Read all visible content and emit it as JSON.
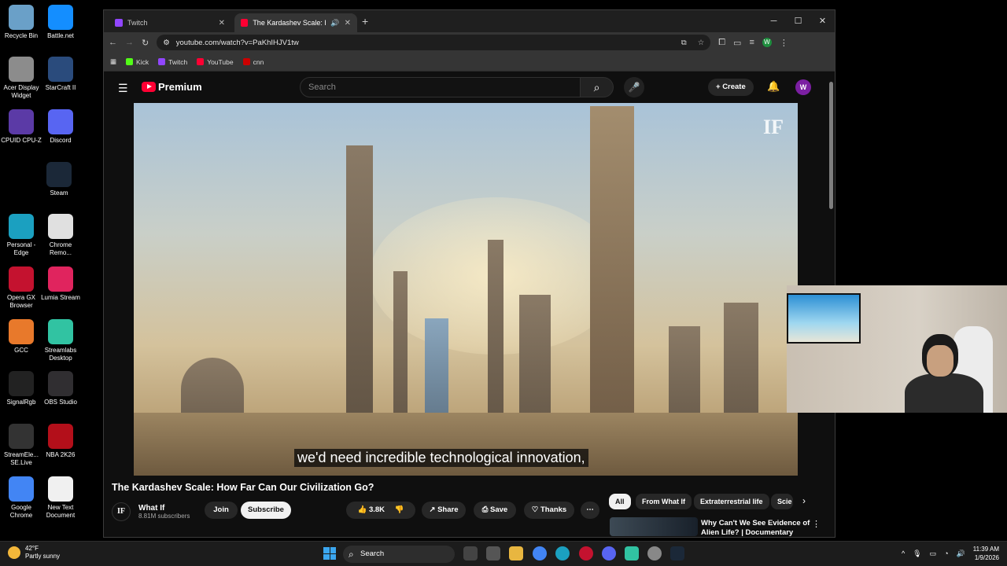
{
  "desktop": {
    "icons": [
      {
        "label": "Recycle Bin",
        "icon": "recycle-bin-icon",
        "color": "#6aa0c8"
      },
      {
        "label": "Battle.net",
        "icon": "battlenet-icon",
        "color": "#148eff"
      },
      {
        "label": "Acer Display Widget",
        "icon": "acer-icon",
        "color": "#8c8c8c"
      },
      {
        "label": "StarCraft II",
        "icon": "starcraft-icon",
        "color": "#2a4b7c"
      },
      {
        "label": "CPUID CPU-Z",
        "icon": "cpuz-icon",
        "color": "#5b3aa6"
      },
      {
        "label": "Discord",
        "icon": "discord-icon",
        "color": "#5865f2"
      },
      {
        "label": "Steam",
        "icon": "steam-icon",
        "color": "#1b2838"
      },
      {
        "label": "Personal - Edge",
        "icon": "edge-icon",
        "color": "#1ba0c0"
      },
      {
        "label": "Chrome Remo...",
        "icon": "chrome-remote-icon",
        "color": "#e0e0e0"
      },
      {
        "label": "Opera GX Browser",
        "icon": "opera-icon",
        "color": "#c4122f"
      },
      {
        "label": "Lumia Stream",
        "icon": "lumia-icon",
        "color": "#e0245e"
      },
      {
        "label": "GCC",
        "icon": "gcc-icon",
        "color": "#e8792b"
      },
      {
        "label": "Streamlabs Desktop",
        "icon": "streamlabs-icon",
        "color": "#31c3a2"
      },
      {
        "label": "SignalRgb",
        "icon": "signalrgb-icon",
        "color": "#222"
      },
      {
        "label": "OBS Studio",
        "icon": "obs-icon",
        "color": "#302e31"
      },
      {
        "label": "StreamEle... SE.Live",
        "icon": "streamelements-icon",
        "color": "#333"
      },
      {
        "label": "NBA 2K26",
        "icon": "nba2k-icon",
        "color": "#b30f1a"
      },
      {
        "label": "Google Chrome",
        "icon": "chrome-icon",
        "color": "#4285f4"
      },
      {
        "label": "New Text Document",
        "icon": "text-document-icon",
        "color": "#f0f0f0"
      }
    ]
  },
  "browser": {
    "tabs": [
      {
        "label": "Twitch",
        "color": "#9146ff"
      },
      {
        "label": "The Kardashev Scale: How F",
        "color": "#ff0033"
      }
    ],
    "url": "youtube.com/watch?v=PaKhIHJV1tw",
    "profile_initial": "W",
    "bookmarks": [
      {
        "label": "Kick",
        "color": "#53fc18"
      },
      {
        "label": "Twitch",
        "color": "#9146ff"
      },
      {
        "label": "YouTube",
        "color": "#ff0033"
      },
      {
        "label": "cnn",
        "color": "#cc0000"
      }
    ]
  },
  "youtube": {
    "brand": "Premium",
    "search_placeholder": "Search",
    "create_label": "Create",
    "user_initial": "W",
    "caption": "we'd need incredible technological innovation,",
    "watermark": "IF",
    "video_title": "The Kardashev Scale: How Far Can Our Civilization Go?",
    "channel": {
      "name": "What If",
      "subscribers": "8.81M subscribers",
      "avatar": "IF"
    },
    "join_label": "Join",
    "subscribe_label": "Subscribe",
    "likes": "3.8K",
    "share_label": "Share",
    "save_label": "Save",
    "thanks_label": "Thanks",
    "chips": [
      "All",
      "From What If",
      "Extraterrestrial life",
      "Scie"
    ],
    "recommended_title": "Why Can't We See Evidence of Alien Life? | Documentary"
  },
  "taskbar": {
    "temp": "42°F",
    "weather": "Partly sunny",
    "search_label": "Search",
    "time": "11:39 AM",
    "date": "1/9/2026"
  }
}
